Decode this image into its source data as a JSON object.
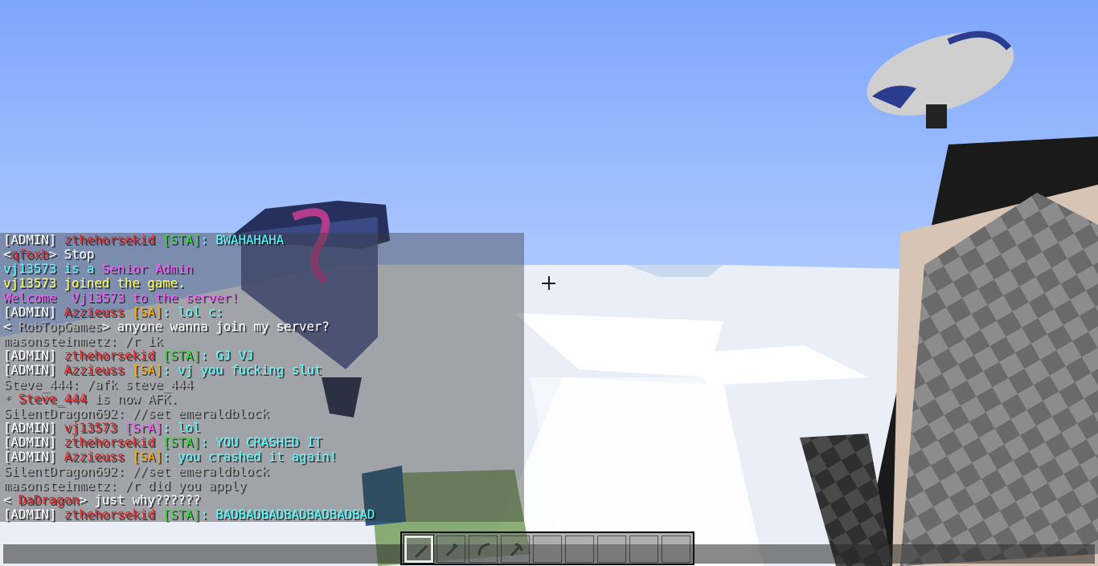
{
  "colors": {
    "sky_top": "#7ea6fb",
    "sky_horizon": "#c8dcff",
    "chat_bg": "rgba(60,60,60,0.42)"
  },
  "crosshair": {
    "icon": "crosshair-icon"
  },
  "chat": {
    "lines": [
      [
        {
          "t": "[ADMIN] ",
          "c": "#ffffff"
        },
        {
          "t": "zthehorsekid ",
          "c": "#e02424"
        },
        {
          "t": "[STA]",
          "c": "#33dd33"
        },
        {
          "t": ": BWAHAHAHA",
          "c": "#55ffff"
        }
      ],
      [
        {
          "t": "<",
          "c": "#ffffff"
        },
        {
          "t": "qfoxb",
          "c": "#e02424"
        },
        {
          "t": "> Stop",
          "c": "#ffffff"
        }
      ],
      [
        {
          "t": "vj13573 is a ",
          "c": "#55ffff"
        },
        {
          "t": "Senior Admin",
          "c": "#ff55ff"
        }
      ],
      [
        {
          "t": "vj13573 joined the game.",
          "c": "#ffff55"
        }
      ],
      [
        {
          "t": "Welcome  Vj13573 to the server!",
          "c": "#ff55ff"
        }
      ],
      [
        {
          "t": "[ADMIN] ",
          "c": "#ffffff"
        },
        {
          "t": "Azzieuss ",
          "c": "#e02424"
        },
        {
          "t": "[SA]",
          "c": "#ffaa00"
        },
        {
          "t": ": lol c:",
          "c": "#55ffff"
        }
      ],
      [
        {
          "t": "< ",
          "c": "#ffffff"
        },
        {
          "t": "RobTopGames",
          "c": "#aaaaaa"
        },
        {
          "t": "> anyone wanna join my server?",
          "c": "#ffffff"
        }
      ],
      [
        {
          "t": "masonsteinmetz: /r ik",
          "c": "#aaaaaa"
        }
      ],
      [
        {
          "t": "[ADMIN] ",
          "c": "#ffffff"
        },
        {
          "t": "zthehorsekid ",
          "c": "#e02424"
        },
        {
          "t": "[STA]",
          "c": "#33dd33"
        },
        {
          "t": ": GJ VJ",
          "c": "#55ffff"
        }
      ],
      [
        {
          "t": "[ADMIN] ",
          "c": "#ffffff"
        },
        {
          "t": "Azzieuss ",
          "c": "#e02424"
        },
        {
          "t": "[SA]",
          "c": "#ffaa00"
        },
        {
          "t": ": vj you fucking slut",
          "c": "#55ffff"
        }
      ],
      [
        {
          "t": "Steve_444: /afk steve_444",
          "c": "#aaaaaa"
        }
      ],
      [
        {
          "t": "* ",
          "c": "#aaaaaa"
        },
        {
          "t": "Steve_444",
          "c": "#e02424"
        },
        {
          "t": " is now AFK.",
          "c": "#aaaaaa"
        }
      ],
      [
        {
          "t": "SilentDragon692: //set emeraldblock",
          "c": "#aaaaaa"
        }
      ],
      [
        {
          "t": "[ADMIN] ",
          "c": "#ffffff"
        },
        {
          "t": "vj13573 ",
          "c": "#e02424"
        },
        {
          "t": "[SrA]",
          "c": "#ff55ff"
        },
        {
          "t": ": lol",
          "c": "#55ffff"
        }
      ],
      [
        {
          "t": "[ADMIN] ",
          "c": "#ffffff"
        },
        {
          "t": "zthehorsekid ",
          "c": "#e02424"
        },
        {
          "t": "[STA]",
          "c": "#33dd33"
        },
        {
          "t": ": YOU CRASHED IT",
          "c": "#55ffff"
        }
      ],
      [
        {
          "t": "[ADMIN] ",
          "c": "#ffffff"
        },
        {
          "t": "Azzieuss ",
          "c": "#e02424"
        },
        {
          "t": "[SA]",
          "c": "#ffaa00"
        },
        {
          "t": ": you crashed it again!",
          "c": "#55ffff"
        }
      ],
      [
        {
          "t": "SilentDragon692: //set emeraldblock",
          "c": "#aaaaaa"
        }
      ],
      [
        {
          "t": "masonsteinmetz: /r did you apply",
          "c": "#aaaaaa"
        }
      ],
      [
        {
          "t": "< ",
          "c": "#ffffff"
        },
        {
          "t": "DaDragon",
          "c": "#e02424"
        },
        {
          "t": "> just why??????",
          "c": "#ffffff"
        }
      ],
      [
        {
          "t": "[ADMIN] ",
          "c": "#ffffff"
        },
        {
          "t": "zthehorsekid ",
          "c": "#e02424"
        },
        {
          "t": "[STA]",
          "c": "#33dd33"
        },
        {
          "t": ": BADBADBADBADBADBADBAD",
          "c": "#55ffff"
        }
      ]
    ],
    "input": {
      "value": ""
    }
  },
  "hotbar": {
    "selected": 0,
    "slots": [
      "sword-icon",
      "hoe-icon",
      "bow-icon",
      "pickaxe-icon",
      "empty",
      "empty",
      "empty",
      "empty",
      "empty"
    ]
  },
  "hand": {
    "item": "stone-sword-icon"
  }
}
